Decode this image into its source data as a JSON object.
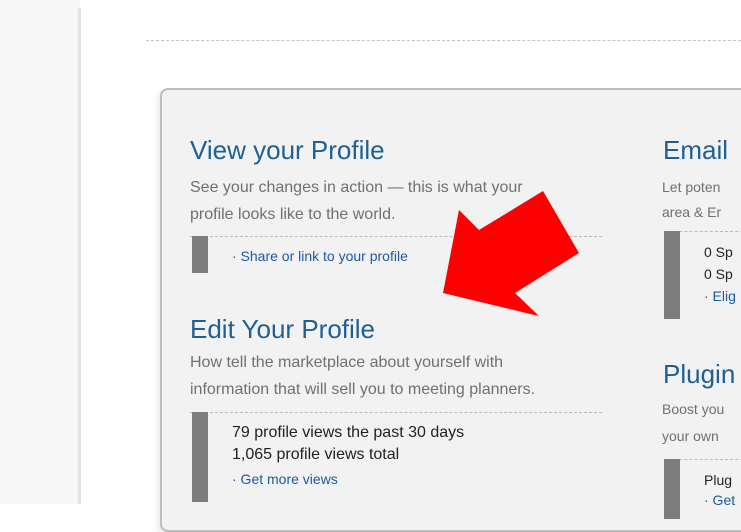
{
  "view_profile": {
    "title": "View your Profile",
    "desc_line1": "See your changes in action — this is what your",
    "desc_line2": "profile looks like to the world.",
    "link": "· Share or link to your profile"
  },
  "edit_profile": {
    "title": "Edit Your Profile",
    "desc_line1": "How tell the marketplace about yourself with",
    "desc_line2": "information that will sell you to meeting planners.",
    "stat1": "79 profile views the past 30 days",
    "stat2": "1,065 profile views total",
    "link": "· Get more views"
  },
  "email": {
    "title": "Email",
    "desc_line1": "Let poten",
    "desc_line2": "area & Er",
    "stat1": "0 Sp",
    "stat2": "0 Sp",
    "link": "· Elig"
  },
  "plugins": {
    "title": "Plugin",
    "desc_line1": "Boost you",
    "desc_line2": "your own",
    "stat1": "Plug",
    "link": "· Get"
  },
  "colors": {
    "title": "#1f5f93",
    "link": "#1b5aa6",
    "arrow": "#ff0000",
    "bar": "#7d7d7d"
  },
  "icons": {
    "annotation": "red-arrow-icon"
  }
}
